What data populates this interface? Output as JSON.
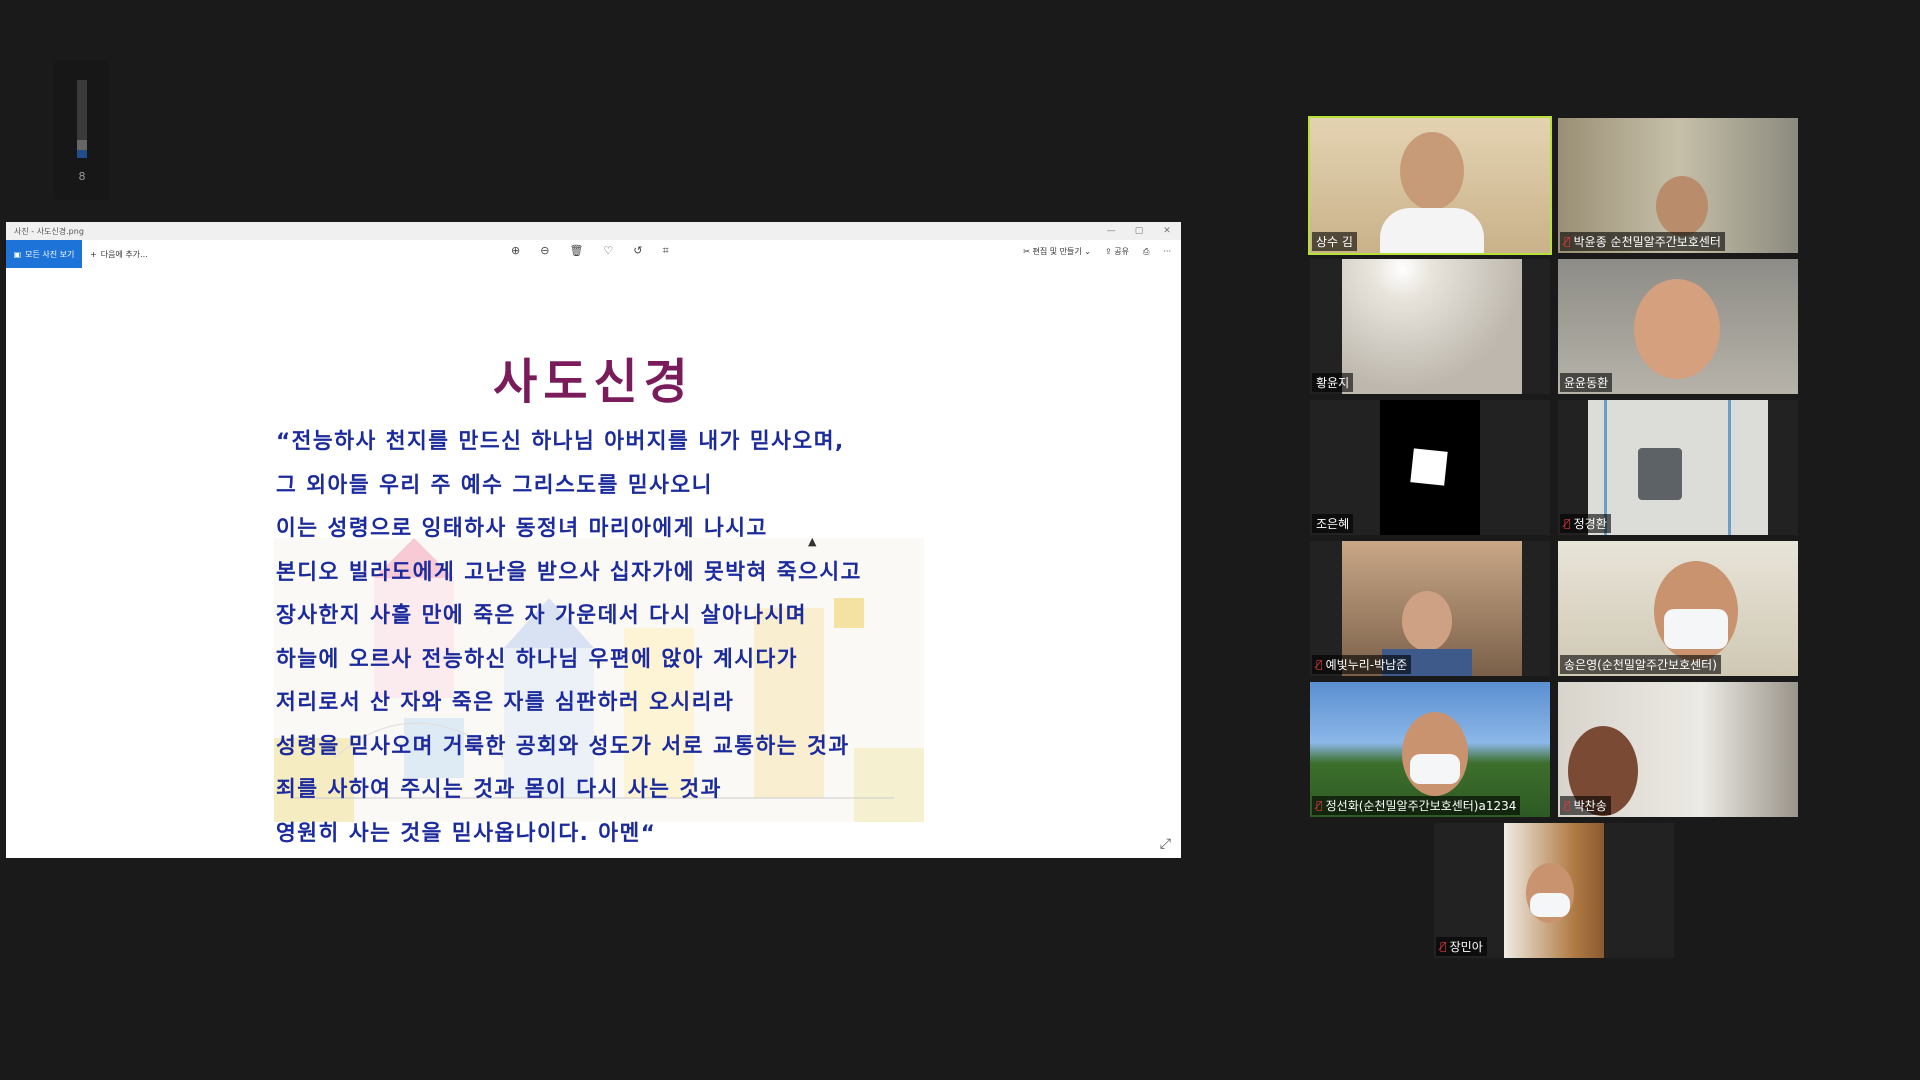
{
  "audio_meter": {
    "level_percent": 18,
    "value": "8"
  },
  "viewer": {
    "window_title": "사진 - 사도신경.png",
    "window_controls": [
      "—",
      "▢",
      "✕"
    ],
    "toolbar": {
      "view_all_label": "모든 사진 보기",
      "add_to_label": "다음에 추가...",
      "edit_create_label": "편집 및 만들기",
      "share_label": "공유"
    },
    "document": {
      "title": "사도신경",
      "lines": [
        "“전능하사 천지를 만드신 하나님 아버지를 내가 믿사오며,",
        "그 외아들 우리 주 예수 그리스도를 믿사오니",
        "이는 성령으로 잉태하사 동정녀 마리아에게 나시고",
        "본디오 빌라도에게 고난을 받으사 십자가에 못박혀 죽으시고",
        "장사한지 사흘 만에 죽은 자 가운데서 다시 살아나시며",
        "하늘에 오르사 전능하신 하나님 우편에 앉아 계시다가",
        "저리로서 산 자와 죽은 자를 심판하러 오시리라",
        "성령을 믿사오며 거룩한 공회와 성도가 서로 교통하는 것과",
        "죄를 사하여 주시는 것과 몸이 다시 사는 것과",
        "영원히 사는 것을 믿사옵나이다. 아멘“"
      ]
    }
  },
  "participants": [
    {
      "name": "상수 김",
      "muted": false,
      "active": true
    },
    {
      "name": "박윤종 순천밀알주간보호센터",
      "muted": true,
      "active": false
    },
    {
      "name": "황윤지",
      "muted": false,
      "active": false
    },
    {
      "name": "윤윤동환",
      "muted": false,
      "active": false
    },
    {
      "name": "조은혜",
      "muted": false,
      "active": false
    },
    {
      "name": "정경환",
      "muted": true,
      "active": false
    },
    {
      "name": "예빛누리-박남준",
      "muted": true,
      "active": false
    },
    {
      "name": "송은영(순천밀알주간보호센터)",
      "muted": false,
      "active": false
    },
    {
      "name": "정선화(순천밀알주간보호센터)a1234",
      "muted": true,
      "active": false
    },
    {
      "name": "박찬송",
      "muted": true,
      "active": false
    },
    {
      "name": "장민아",
      "muted": true,
      "active": false
    }
  ],
  "colors": {
    "background": "#1a1a1a",
    "active_speaker": "#b7e13a",
    "title_color": "#7a1c5c",
    "text_color": "#1b2a9c",
    "accent": "#1e73d8"
  }
}
